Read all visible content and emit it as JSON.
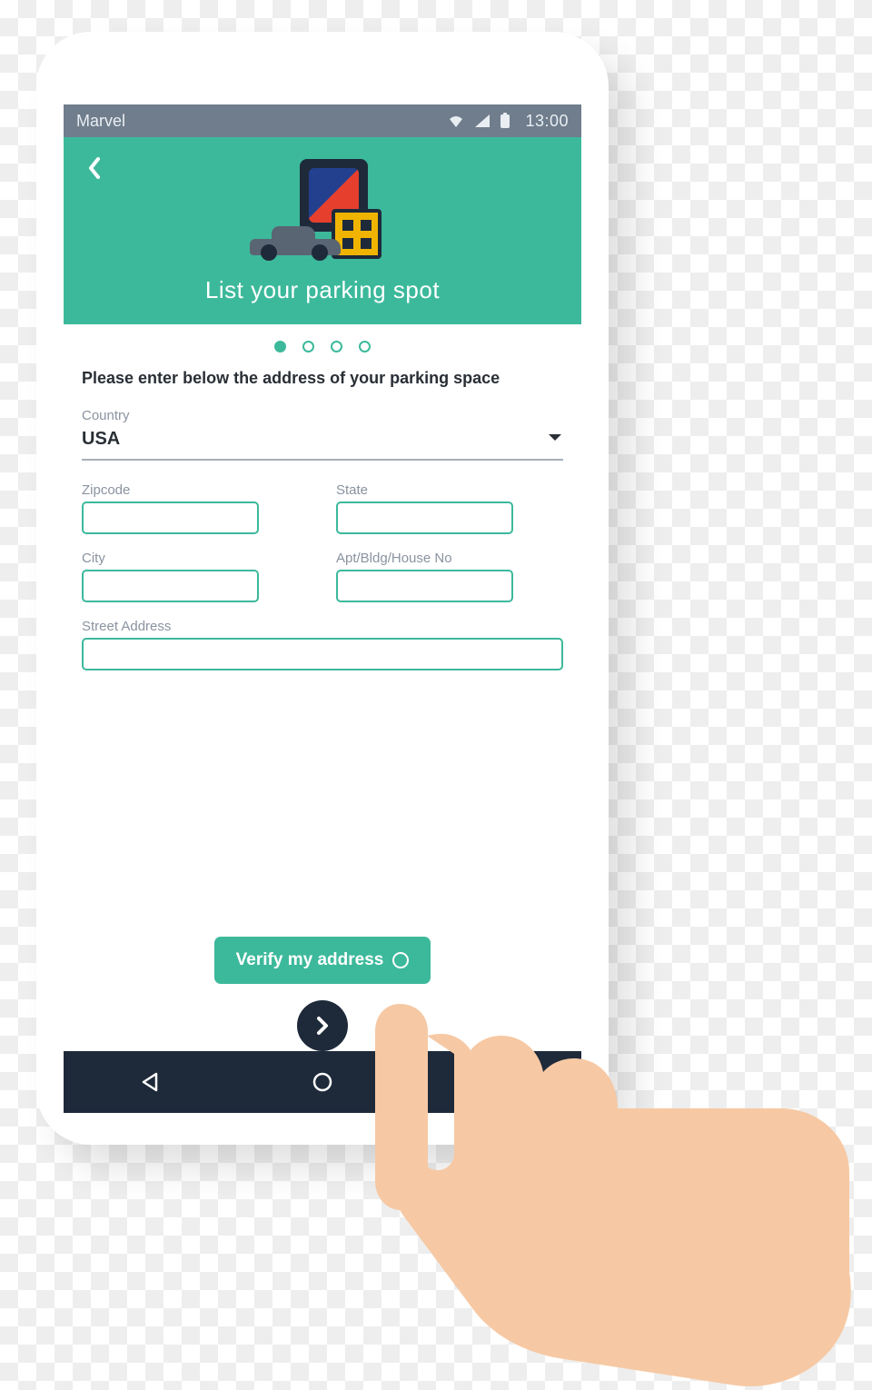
{
  "statusbar": {
    "carrier": "Marvel",
    "clock": "13:00"
  },
  "header": {
    "title": "List your parking spot"
  },
  "progress": {
    "total": 4,
    "active_index": 0
  },
  "form": {
    "instruction": "Please enter below the address of your parking space",
    "country": {
      "label": "Country",
      "value": "USA"
    },
    "zipcode": {
      "label": "Zipcode",
      "value": ""
    },
    "state": {
      "label": "State",
      "value": ""
    },
    "city": {
      "label": "City",
      "value": ""
    },
    "apt": {
      "label": "Apt/Bldg/House No",
      "value": ""
    },
    "street": {
      "label": "Street Address",
      "value": ""
    },
    "verify_label": "Verify my address"
  },
  "colors": {
    "accent": "#3cb99b",
    "dark": "#1e2a3a",
    "statusbar": "#6f7d8c"
  }
}
